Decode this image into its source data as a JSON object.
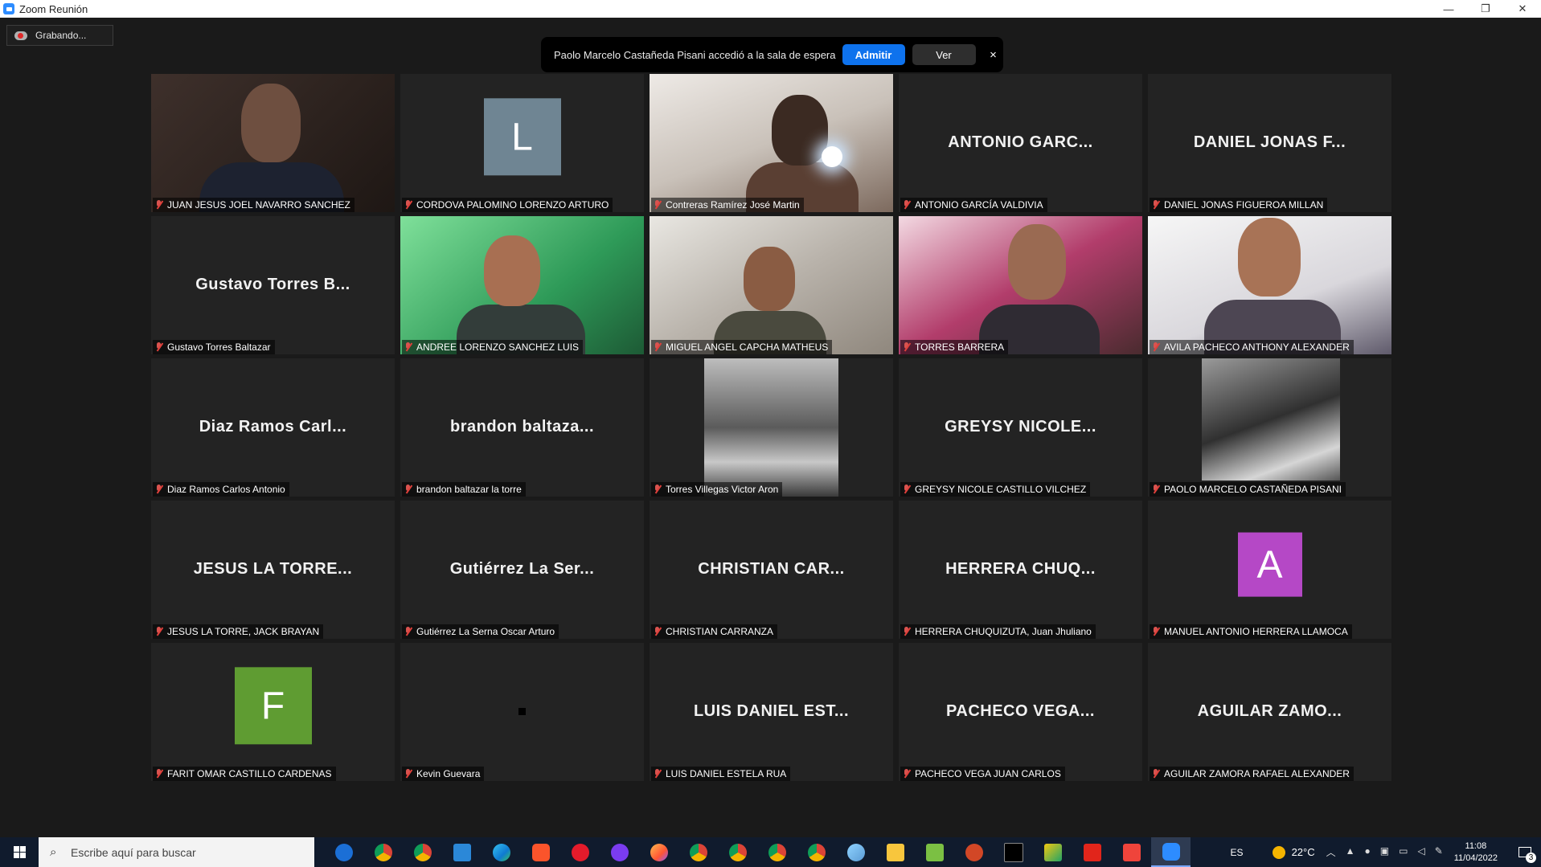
{
  "window": {
    "title": "Zoom Reunión",
    "controls": [
      "—",
      "❐",
      "✕"
    ]
  },
  "recording": {
    "label": "Grabando..."
  },
  "waiting_room": {
    "message": "Paolo Marcelo Castañeda Pisani accedió a la sala de espera",
    "admit_label": "Admitir",
    "view_label": "Ver",
    "close_label": "×"
  },
  "participants": [
    {
      "name": "JUAN JESUS JOEL NAVARRO SANCHEZ",
      "display": "",
      "muted": true
    },
    {
      "name": "CORDOVA PALOMINO LORENZO ARTURO",
      "avatar_letter": "L",
      "avatar_color": "#6f8593",
      "muted": true
    },
    {
      "name": "Contreras Ramírez  José Martin",
      "muted": true
    },
    {
      "name": "ANTONIO GARCÍA VALDIVIA",
      "display": "ANTONIO  GARC...",
      "muted": true
    },
    {
      "name": "DANIEL JONAS FIGUEROA MILLAN",
      "display": "DANIEL  JONAS  F...",
      "muted": true
    },
    {
      "name": "Gustavo Torres Baltazar",
      "display": "Gustavo Torres B...",
      "muted": true
    },
    {
      "name": "ANDREE LORENZO SANCHEZ LUIS",
      "muted": true
    },
    {
      "name": "MIGUEL ANGEL CAPCHA MATHEUS",
      "muted": true
    },
    {
      "name": "TORRES BARRERA",
      "muted": true
    },
    {
      "name": "AVILA PACHECO ANTHONY ALEXANDER",
      "muted": true
    },
    {
      "name": "Diaz Ramos Carlos Antonio",
      "display": "Diaz Ramos Carl...",
      "muted": true
    },
    {
      "name": "brandon baltazar la torre",
      "display": "brandon baltaza...",
      "muted": true
    },
    {
      "name": "Torres Villegas Victor Aron",
      "muted": true
    },
    {
      "name": "GREYSY NICOLE CASTILLO VILCHEZ",
      "display": "GREYSY  NICOLE...",
      "muted": true
    },
    {
      "name": "PAOLO MARCELO CASTAÑEDA PISANI",
      "muted": true
    },
    {
      "name": "JESUS LA TORRE, JACK BRAYAN",
      "display": "JESUS  LA  TORRE...",
      "muted": true
    },
    {
      "name": "Gutiérrez La Serna Oscar Arturo",
      "display": "Gutiérrez  La  Ser...",
      "muted": true
    },
    {
      "name": "CHRISTIAN CARRANZA",
      "display": "CHRISTIAN  CAR...",
      "muted": true
    },
    {
      "name": "HERRERA CHUQUIZUTA, Juan Jhuliano",
      "display": "HERRERA  CHUQ...",
      "muted": true
    },
    {
      "name": "MANUEL ANTONIO HERRERA LLAMOCA",
      "avatar_letter": "A",
      "avatar_color": "#b548c6",
      "muted": true
    },
    {
      "name": "FARIT OMAR CASTILLO CARDENAS",
      "avatar_letter": "F",
      "avatar_color": "#5f9c32",
      "muted": true
    },
    {
      "name": "Kevin Guevara",
      "muted": true
    },
    {
      "name": "LUIS DANIEL ESTELA RUA",
      "display": "LUIS  DANIEL  EST...",
      "muted": true
    },
    {
      "name": "PACHECO VEGA JUAN CARLOS",
      "display": "PACHECO  VEGA...",
      "muted": true
    },
    {
      "name": "AGUILAR ZAMORA RAFAEL ALEXANDER",
      "display": "AGUILAR  ZAMO...",
      "muted": true
    }
  ],
  "taskbar": {
    "search_placeholder": "Escribe aquí para buscar",
    "apps": [
      "cortana-icon",
      "chrome-icon",
      "chrome-icon",
      "mail-icon",
      "edge-icon",
      "brave-icon",
      "opera-icon",
      "vpn-icon",
      "firefox-icon",
      "chrome-icon",
      "chrome-icon",
      "chrome-icon",
      "chrome-icon",
      "paint-icon",
      "explorer-icon",
      "notepad-icon",
      "powerpoint-icon",
      "terminal-icon",
      "excel-icon",
      "acrobat-icon",
      "anydesk-icon",
      "zoom-icon"
    ],
    "language": "ES",
    "temperature": "22°C",
    "time": "11:08",
    "date": "11/04/2022",
    "notifications": "3"
  }
}
